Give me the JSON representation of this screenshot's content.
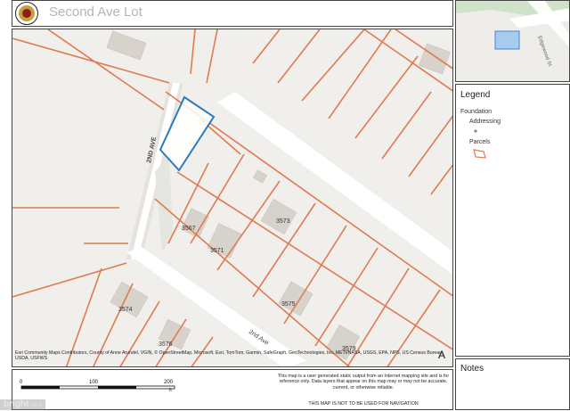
{
  "title": "Second Ave Lot",
  "map": {
    "road_labels": {
      "road_2nd_ave_vertical": "2ND AVE",
      "road_2nd_ave_diagonal": "2nd Ave"
    },
    "address_labels": [
      "3567",
      "3573",
      "3571",
      "3574",
      "3575",
      "3576",
      "3579"
    ],
    "attribution": "Esri Community Maps Contributors, County of Anne Arundel, VGIN, © OpenStreetMap, Microsoft, Esri, TomTom, Garmin, SafeGraph, GeoTechnologies, Inc, METI/NASA, USGS, EPA, NPS, US Census Bureau, USDA, USFWS",
    "north_arrow": "A",
    "colors": {
      "parcel": "#e07a4f",
      "selected_parcel": "#2b7bbd",
      "road": "#ffffff",
      "background": "#f1efec"
    }
  },
  "inset": {
    "street_label": "Edgewood St"
  },
  "legend": {
    "title": "Legend",
    "items": {
      "foundation": "Foundation",
      "addressing": "Addressing",
      "parcels": "Parcels"
    }
  },
  "notes": {
    "title": "Notes"
  },
  "footer": {
    "scale": {
      "labels": [
        "0",
        "100",
        "200"
      ],
      "unit": "ft"
    },
    "disclaimer": "This map is a user generated static output from an Internet mapping site and is for reference only. Data layers that appear on this map may or may not be accurate, current, or otherwise reliable.",
    "nav_warning": "THIS MAP IS NOT TO BE USED FOR NAVIGATION"
  },
  "watermark": {
    "brand": "bright",
    "suffix": "MLS"
  }
}
